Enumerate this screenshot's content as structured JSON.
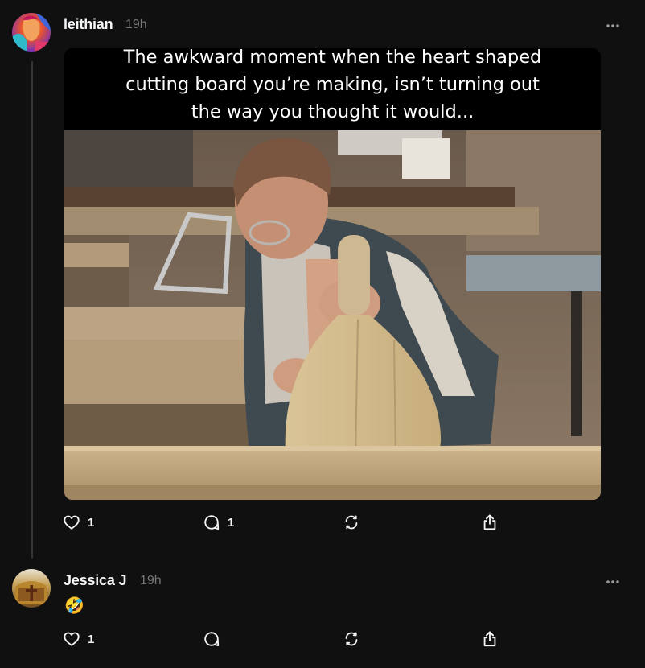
{
  "post": {
    "username": "leithian",
    "time": "19h",
    "image_caption": "The awkward moment when the heart shaped\ncutting board you’re making, isn’t turning out\nthe way you thought it would...",
    "actions": {
      "like_count": "1",
      "reply_count": "1"
    }
  },
  "reply": {
    "username": "Jessica J",
    "time": "19h",
    "text": "🤣",
    "actions": {
      "like_count": "1"
    }
  },
  "icons": {
    "like": "heart-icon",
    "reply": "comment-icon",
    "repost": "repost-icon",
    "share": "share-icon",
    "more": "more-dots-icon"
  },
  "colors": {
    "background": "#101010",
    "text": "#f3f5f7",
    "muted": "#777777",
    "thread_line": "#333638"
  }
}
